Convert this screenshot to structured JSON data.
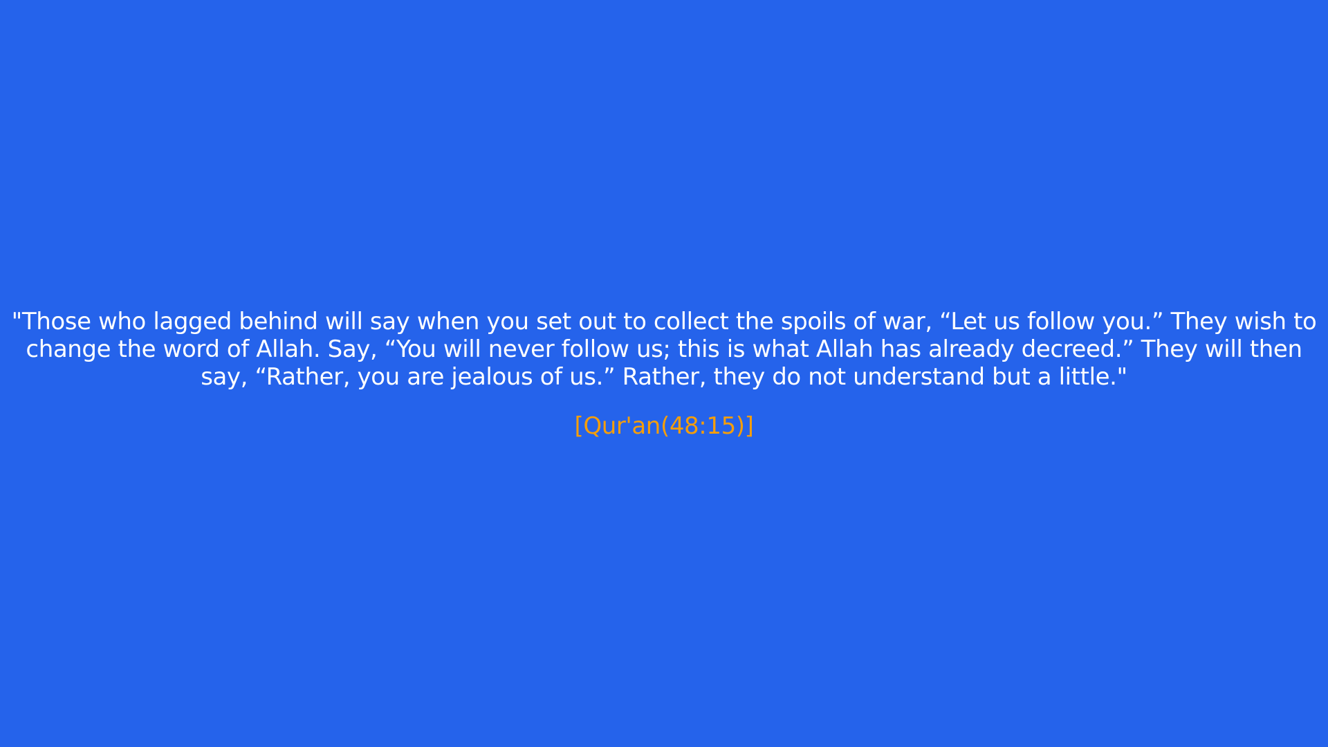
{
  "quote": {
    "text": "\"Those who lagged behind will say when you set out to collect the spoils of war, “Let us follow you.” They wish to change the word of Allah. Say, “You will never follow us; this is what Allah has already decreed.” They will then say, “Rather, you are jealous of us.” Rather, they do not understand but a little.\"",
    "reference": "[Qur'an(48:15)]"
  },
  "colors": {
    "background": "#2563eb",
    "quote_text": "#ffffff",
    "reference_text": "#f59e0b"
  }
}
